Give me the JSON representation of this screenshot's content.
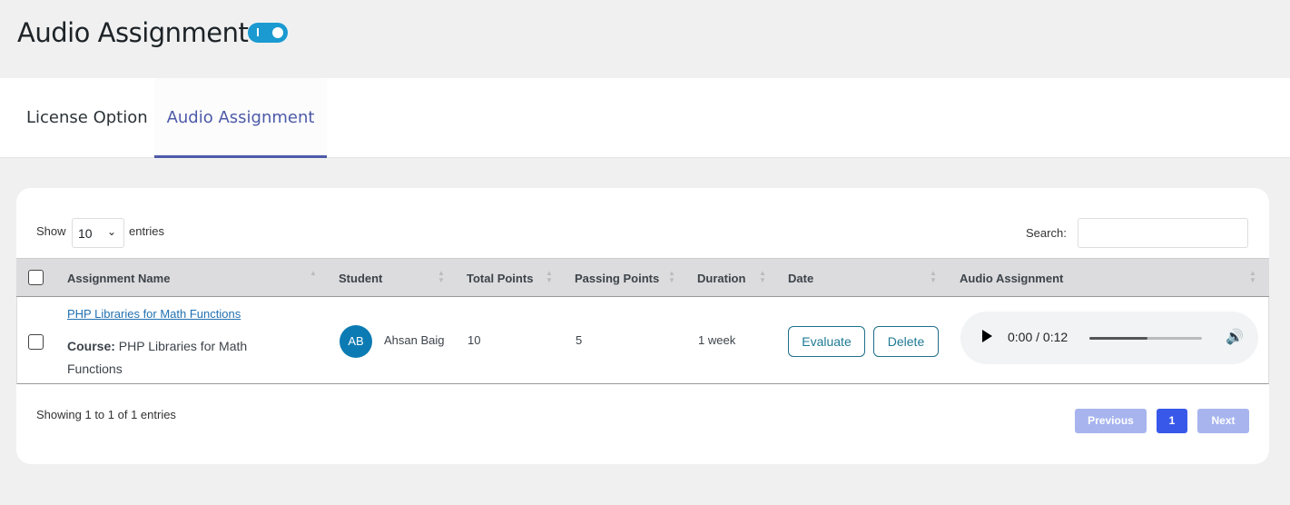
{
  "page": {
    "title": "Audio Assignment",
    "toggle_on": true,
    "toggle_color": "#1a9ad1"
  },
  "tabs": [
    {
      "label": "License Option",
      "active": false
    },
    {
      "label": "Audio Assignment",
      "active": true
    }
  ],
  "table_controls": {
    "show_label": "Show",
    "page_size": "10",
    "entries_label": "entries",
    "search_label": "Search:",
    "search_value": ""
  },
  "columns": [
    "Assignment Name",
    "Student",
    "Total Points",
    "Passing Points",
    "Duration",
    "Date",
    "Audio Assignment"
  ],
  "rows": [
    {
      "assignment": "PHP Libraries for Math Functions",
      "course_label": "Course:",
      "course": "PHP Libraries for Math Functions",
      "student_initials": "AB",
      "student": "Ahsan Baig",
      "total_points": "10",
      "passing_points": "5",
      "duration": "1 week",
      "evaluate": "Evaluate",
      "delete": "Delete",
      "audio_time": "0:00 / 0:12",
      "audio_progress": 0.52
    }
  ],
  "footer": {
    "info": "Showing 1 to 1 of 1 entries",
    "previous": "Previous",
    "page": "1",
    "next": "Next"
  },
  "colors": {
    "accent": "#4d5aa8",
    "page_active": "#3858e9",
    "page_disabled": "#a7b4ee"
  }
}
